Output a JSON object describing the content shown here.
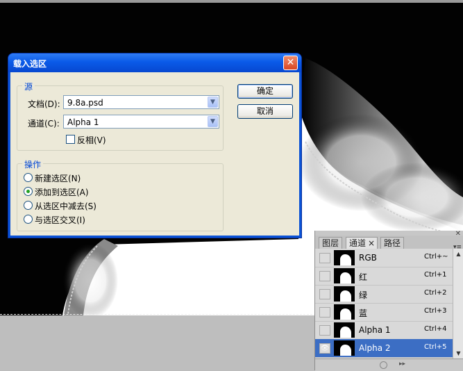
{
  "dialog": {
    "title": "载入选区",
    "source_group": {
      "legend": "源",
      "document_label": "文档(D):",
      "document_value": "9.8a.psd",
      "channel_label": "通道(C):",
      "channel_value": "Alpha 1",
      "invert_label": "反相(V)",
      "invert_checked": false
    },
    "operation_group": {
      "legend": "操作",
      "options": [
        {
          "label": "新建选区(N)",
          "selected": false
        },
        {
          "label": "添加到选区(A)",
          "selected": true
        },
        {
          "label": "从选区中减去(S)",
          "selected": false
        },
        {
          "label": "与选区交叉(I)",
          "selected": false
        }
      ]
    },
    "ok_label": "确定",
    "cancel_label": "取消",
    "close_glyph": "✕"
  },
  "panel": {
    "tabs": [
      {
        "label": "图层",
        "active": false
      },
      {
        "label": "通道",
        "active": true
      },
      {
        "label": "路径",
        "active": false
      }
    ],
    "tab_close_glyph": "×",
    "channels": [
      {
        "name": "RGB",
        "shortcut": "Ctrl+~",
        "visible": false,
        "selected": false
      },
      {
        "name": "红",
        "shortcut": "Ctrl+1",
        "visible": false,
        "selected": false
      },
      {
        "name": "绿",
        "shortcut": "Ctrl+2",
        "visible": false,
        "selected": false
      },
      {
        "name": "蓝",
        "shortcut": "Ctrl+3",
        "visible": false,
        "selected": false
      },
      {
        "name": "Alpha 1",
        "shortcut": "Ctrl+4",
        "visible": false,
        "selected": false
      },
      {
        "name": "Alpha 2",
        "shortcut": "Ctrl+5",
        "visible": true,
        "selected": true
      }
    ]
  }
}
